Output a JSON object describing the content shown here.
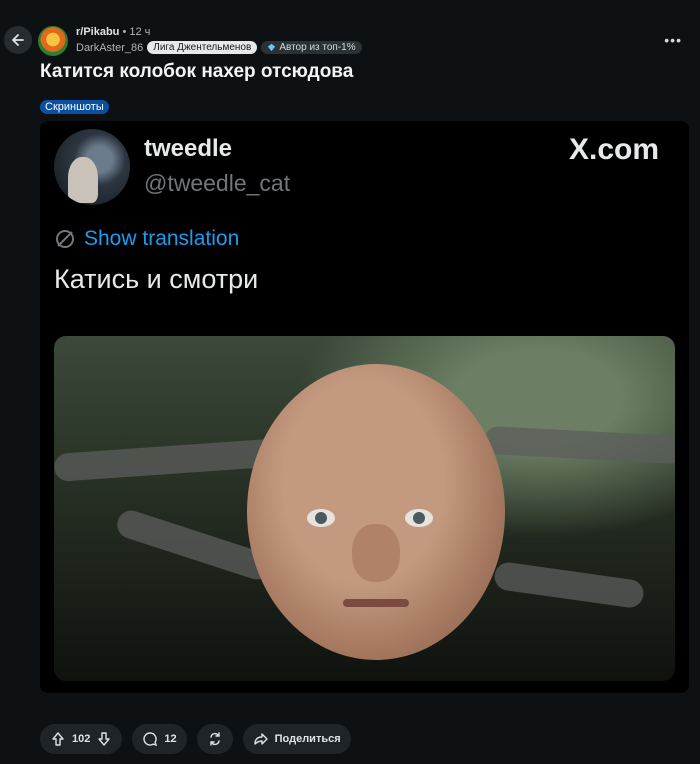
{
  "post": {
    "subreddit": "r/Pikabu",
    "time": "• 12 ч",
    "author": "DarkAster_86",
    "flair_league": "Лига Джентельменов",
    "flair_author": "Автор из топ-1%",
    "title": "Катится колобок нахер отсюдова",
    "tag": "Скриншоты"
  },
  "tweet": {
    "name": "tweedle",
    "handle": "@tweedle_cat",
    "site": "X.com",
    "translation": "Show translation",
    "text": "Катись и смотри"
  },
  "actions": {
    "votes": "102",
    "comments": "12",
    "share": "Поделиться"
  },
  "icons": [
    "arrow-left-icon",
    "more-icon",
    "diamond-icon",
    "translate-icon",
    "upvote-icon",
    "downvote-icon",
    "comment-icon",
    "repost-icon",
    "share-icon"
  ]
}
